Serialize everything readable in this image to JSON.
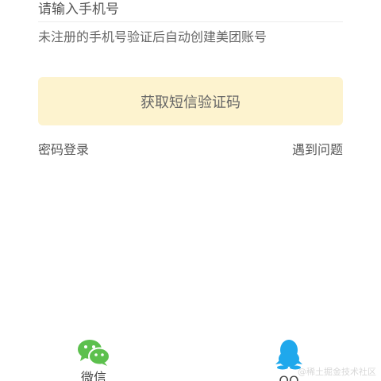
{
  "form": {
    "phone_placeholder": "请输入手机号",
    "hint": "未注册的手机号验证后自动创建美团账号",
    "sms_button": "获取短信验证码"
  },
  "links": {
    "password_login": "密码登录",
    "help": "遇到问题"
  },
  "social": {
    "wechat_label": "微信",
    "qq_label": "QQ",
    "wechat_icon": "wechat-icon",
    "qq_icon": "qq-icon",
    "wechat_color": "#5cc04d",
    "qq_color": "#1fa8ec"
  },
  "watermark": "@稀土掘金技术社区"
}
